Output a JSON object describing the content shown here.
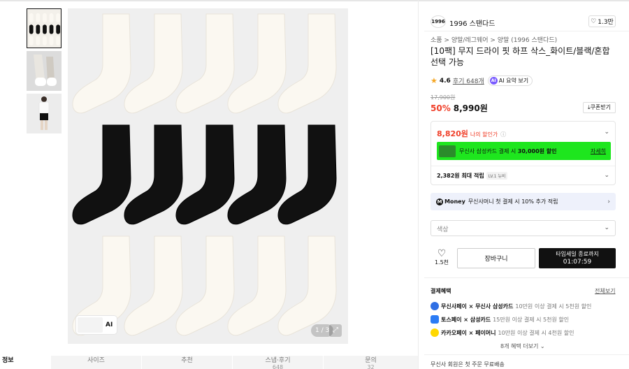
{
  "thumbnails": [
    "sock-pack-thumb",
    "model-sock-thumb",
    "model-full-thumb"
  ],
  "main_image": {
    "ai_chip_label": "AI",
    "counter": "1 / 3",
    "expand_icon": "expand-icon"
  },
  "tabs": [
    {
      "label": "정보",
      "sub": ""
    },
    {
      "label": "사이즈",
      "sub": ""
    },
    {
      "label": "추천",
      "sub": ""
    },
    {
      "label": "스냅·후기",
      "sub": "648"
    },
    {
      "label": "문의",
      "sub": "32"
    }
  ],
  "brand": {
    "logo": "1996",
    "name": "1996 스탠다드",
    "likes": "1.3만"
  },
  "breadcrumb": "소품  >  양말/레그웨어  >  양말 (1996 스탠다드)",
  "title": "[10팩] 무지 드라이 핏 하프 삭스_화이트/블랙/혼합선택 가능",
  "rating": {
    "score": "4.6",
    "reviews": "후기 648개",
    "ai_label": "AI 요약 보기"
  },
  "price": {
    "original": "17,900원",
    "discount": "50%",
    "sale": "8,990원",
    "coupon_label": "쿠폰받기"
  },
  "benefit": {
    "my_price": "8,820원",
    "my_price_label": "나의 할인가",
    "card_promo_text": "무신사 삼성카드 결제 시 ",
    "card_promo_bold": "30,000원 할인",
    "card_promo_more": "자세히",
    "points": "2,382원 최대 적립",
    "level": "LV.1 뉴비"
  },
  "money": {
    "logo": "Money",
    "text": "무신사머니 첫 결제 시 10% 추가 적립"
  },
  "select_placeholder": "색상",
  "actions": {
    "like_count": "1.5천",
    "cart_label": "장바구니",
    "buy_title": "타임세일 종료까지",
    "buy_timer": "01:07:59"
  },
  "payment": {
    "title": "결제혜택",
    "view_all": "전체보기",
    "rows": [
      {
        "bold": "무신사페이 × 무신사 삼성카드",
        "text": " 10만원 이상 결제 시 5천원 할인",
        "color": "#2f6fe4"
      },
      {
        "bold": "토스페이 × 삼성카드",
        "text": " 15만원 이상 결제 시 5천원 할인",
        "color": "#2b7bf5"
      },
      {
        "bold": "카카오페이 × 페이머니",
        "text": " 10만원 이상 결제 시 4천원 할인",
        "color": "#ffd800"
      }
    ],
    "more": "8개 혜택 더보기"
  },
  "shipping": "무신사 회원은 첫 주문 무료배송"
}
